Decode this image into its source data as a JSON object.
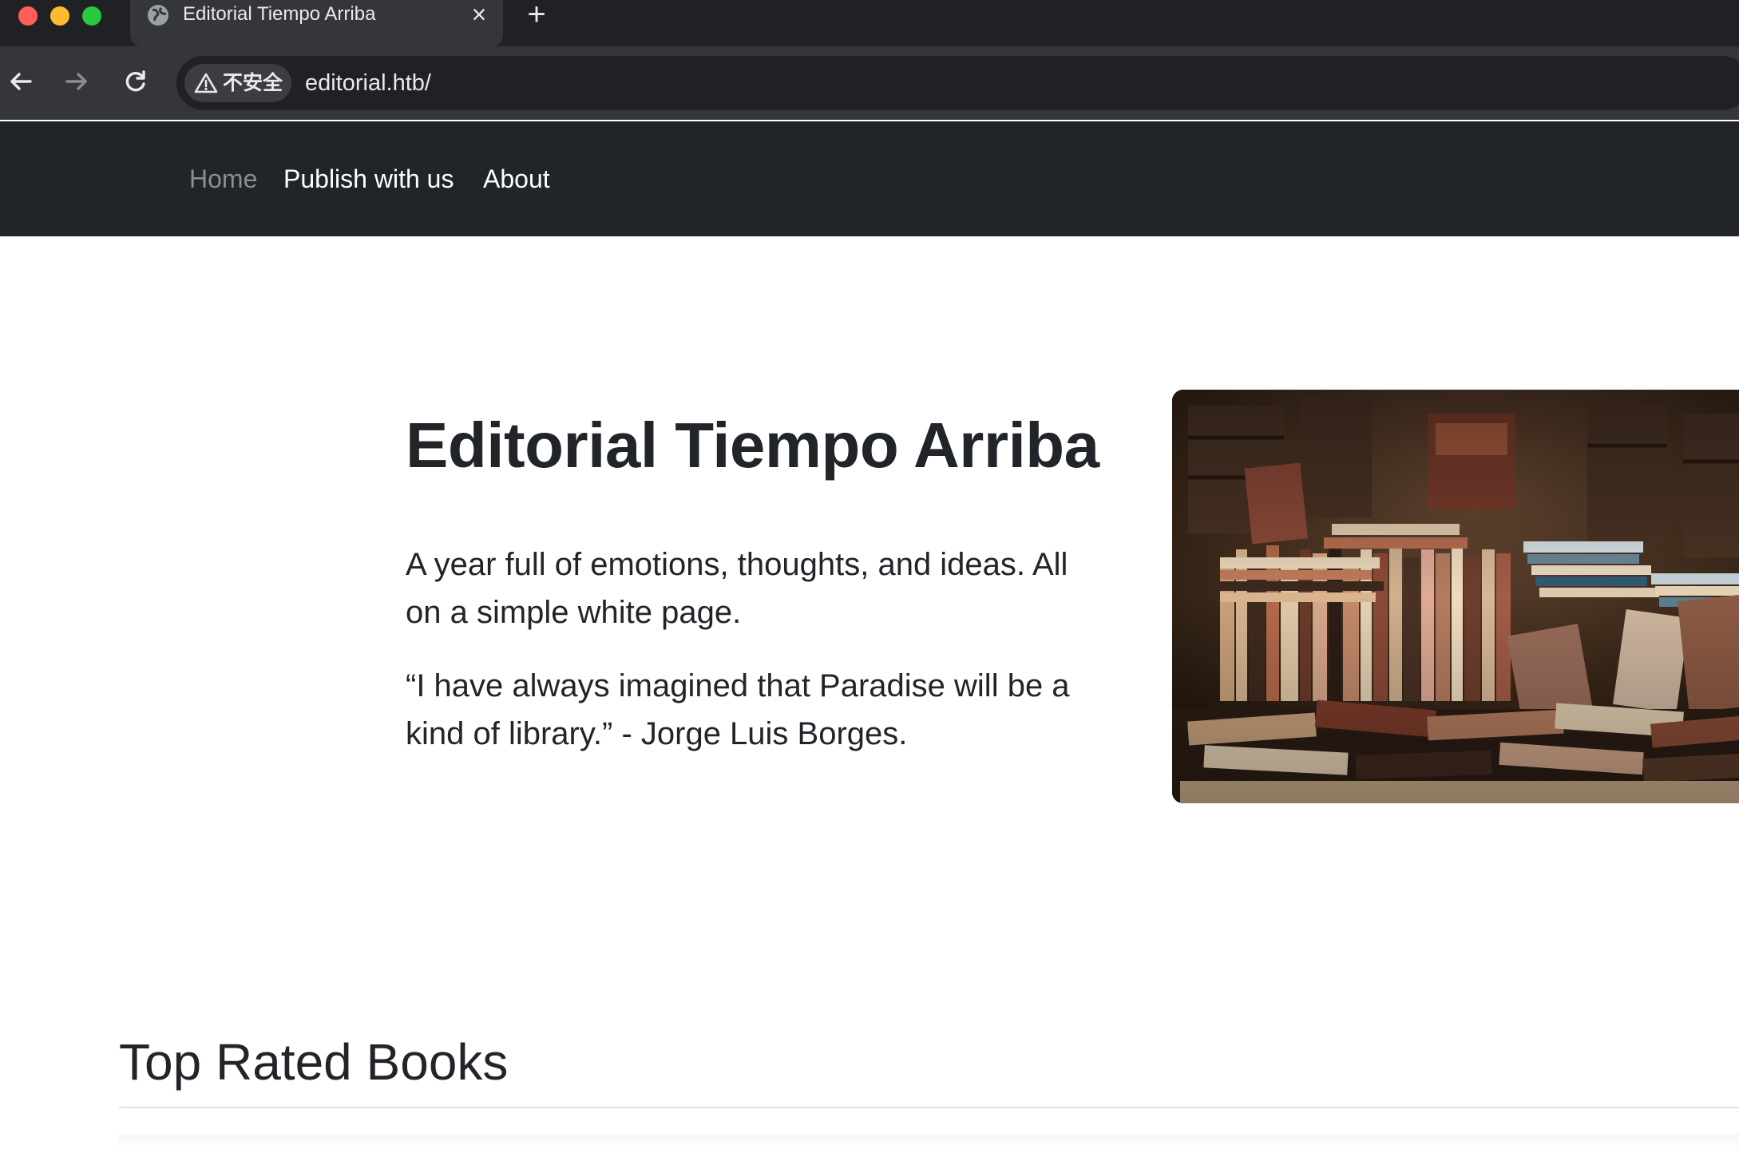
{
  "browser": {
    "tab": {
      "title": "Editorial Tiempo Arriba",
      "favicon": "globe-icon",
      "close": "×"
    },
    "new_tab": "+",
    "security_label": "不安全",
    "url": "editorial.htb/"
  },
  "nav": {
    "items": [
      {
        "label": "Home",
        "active": true
      },
      {
        "label": "Publish with us"
      },
      {
        "label": "About"
      }
    ]
  },
  "hero": {
    "title": "Editorial Tiempo Arriba",
    "lead": "A year full of emotions, thoughts, and ideas. All on a simple white page.",
    "quote": "“I have always imagined that Paradise will be a kind of library.” - Jorge Luis Borges.",
    "image": "stacked-books-photo"
  },
  "section": {
    "title": "Top Rated Books"
  },
  "colors": {
    "chrome_dark": "#202124",
    "chrome_toolbar": "#35363a",
    "site_nav": "#212529",
    "text": "#212529",
    "nav_muted": "#8a8d91"
  }
}
